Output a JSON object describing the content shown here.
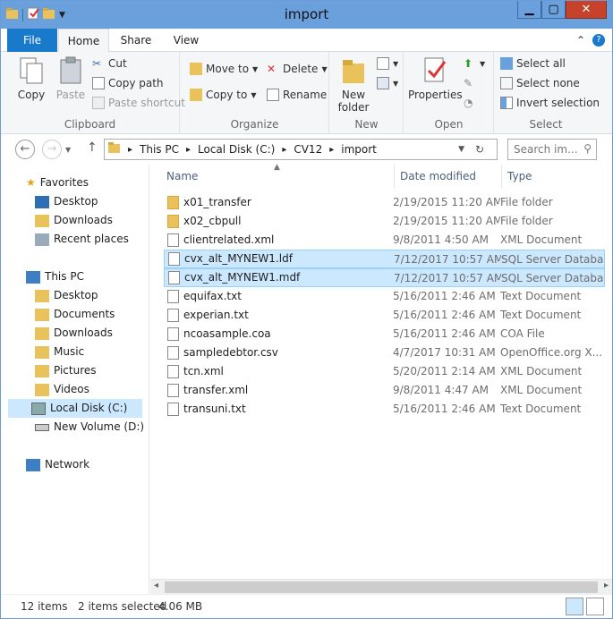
{
  "window": {
    "title": "import"
  },
  "ribbon_tabs": {
    "file": "File",
    "home": "Home",
    "share": "Share",
    "view": "View"
  },
  "clipboard": {
    "copy": "Copy",
    "paste": "Paste",
    "cut": "Cut",
    "copy_path": "Copy path",
    "paste_shortcut": "Paste shortcut",
    "label": "Clipboard"
  },
  "organize": {
    "move_to": "Move to",
    "copy_to": "Copy to",
    "delete": "Delete",
    "rename": "Rename",
    "label": "Organize"
  },
  "new": {
    "new_folder_line1": "New",
    "new_folder_line2": "folder",
    "label": "New"
  },
  "open": {
    "properties": "Properties",
    "label": "Open"
  },
  "select": {
    "select_all": "Select all",
    "select_none": "Select none",
    "invert": "Invert selection",
    "label": "Select"
  },
  "address": {
    "parts": [
      "This PC",
      "Local Disk (C:)",
      "CV12",
      "import"
    ]
  },
  "search": {
    "placeholder": "Search im..."
  },
  "nav": {
    "favorites": "Favorites",
    "desktop": "Desktop",
    "downloads": "Downloads",
    "recent": "Recent places",
    "thispc": "This PC",
    "pc_desktop": "Desktop",
    "pc_documents": "Documents",
    "pc_downloads": "Downloads",
    "pc_music": "Music",
    "pc_pictures": "Pictures",
    "pc_videos": "Videos",
    "local_disk": "Local Disk (C:)",
    "new_volume": "New Volume (D:)",
    "network": "Network"
  },
  "columns": {
    "name": "Name",
    "date": "Date modified",
    "type": "Type"
  },
  "files": [
    {
      "name": "x01_transfer",
      "date": "2/19/2015 11:20 AM",
      "type": "File folder"
    },
    {
      "name": "x02_cbpull",
      "date": "2/19/2015 11:20 AM",
      "type": "File folder"
    },
    {
      "name": "clientrelated.xml",
      "date": "9/8/2011 4:50 AM",
      "type": "XML Document"
    },
    {
      "name": "cvx_alt_MYNEW1.ldf",
      "date": "7/12/2017 10:57 AM",
      "type": "SQL Server Databa..."
    },
    {
      "name": "cvx_alt_MYNEW1.mdf",
      "date": "7/12/2017 10:57 AM",
      "type": "SQL Server Databa..."
    },
    {
      "name": "equifax.txt",
      "date": "5/16/2011 2:46 AM",
      "type": "Text Document"
    },
    {
      "name": "experian.txt",
      "date": "5/16/2011 2:46 AM",
      "type": "Text Document"
    },
    {
      "name": "ncoasample.coa",
      "date": "5/16/2011 2:46 AM",
      "type": "COA File"
    },
    {
      "name": "sampledebtor.csv",
      "date": "4/7/2017 10:31 AM",
      "type": "OpenOffice.org X..."
    },
    {
      "name": "tcn.xml",
      "date": "5/20/2011 2:14 AM",
      "type": "XML Document"
    },
    {
      "name": "transfer.xml",
      "date": "9/8/2011 4:47 AM",
      "type": "XML Document"
    },
    {
      "name": "transuni.txt",
      "date": "5/16/2011 2:46 AM",
      "type": "Text Document"
    }
  ],
  "status": {
    "items": "12 items",
    "selected": "2 items selected",
    "size": "4.06 MB"
  }
}
